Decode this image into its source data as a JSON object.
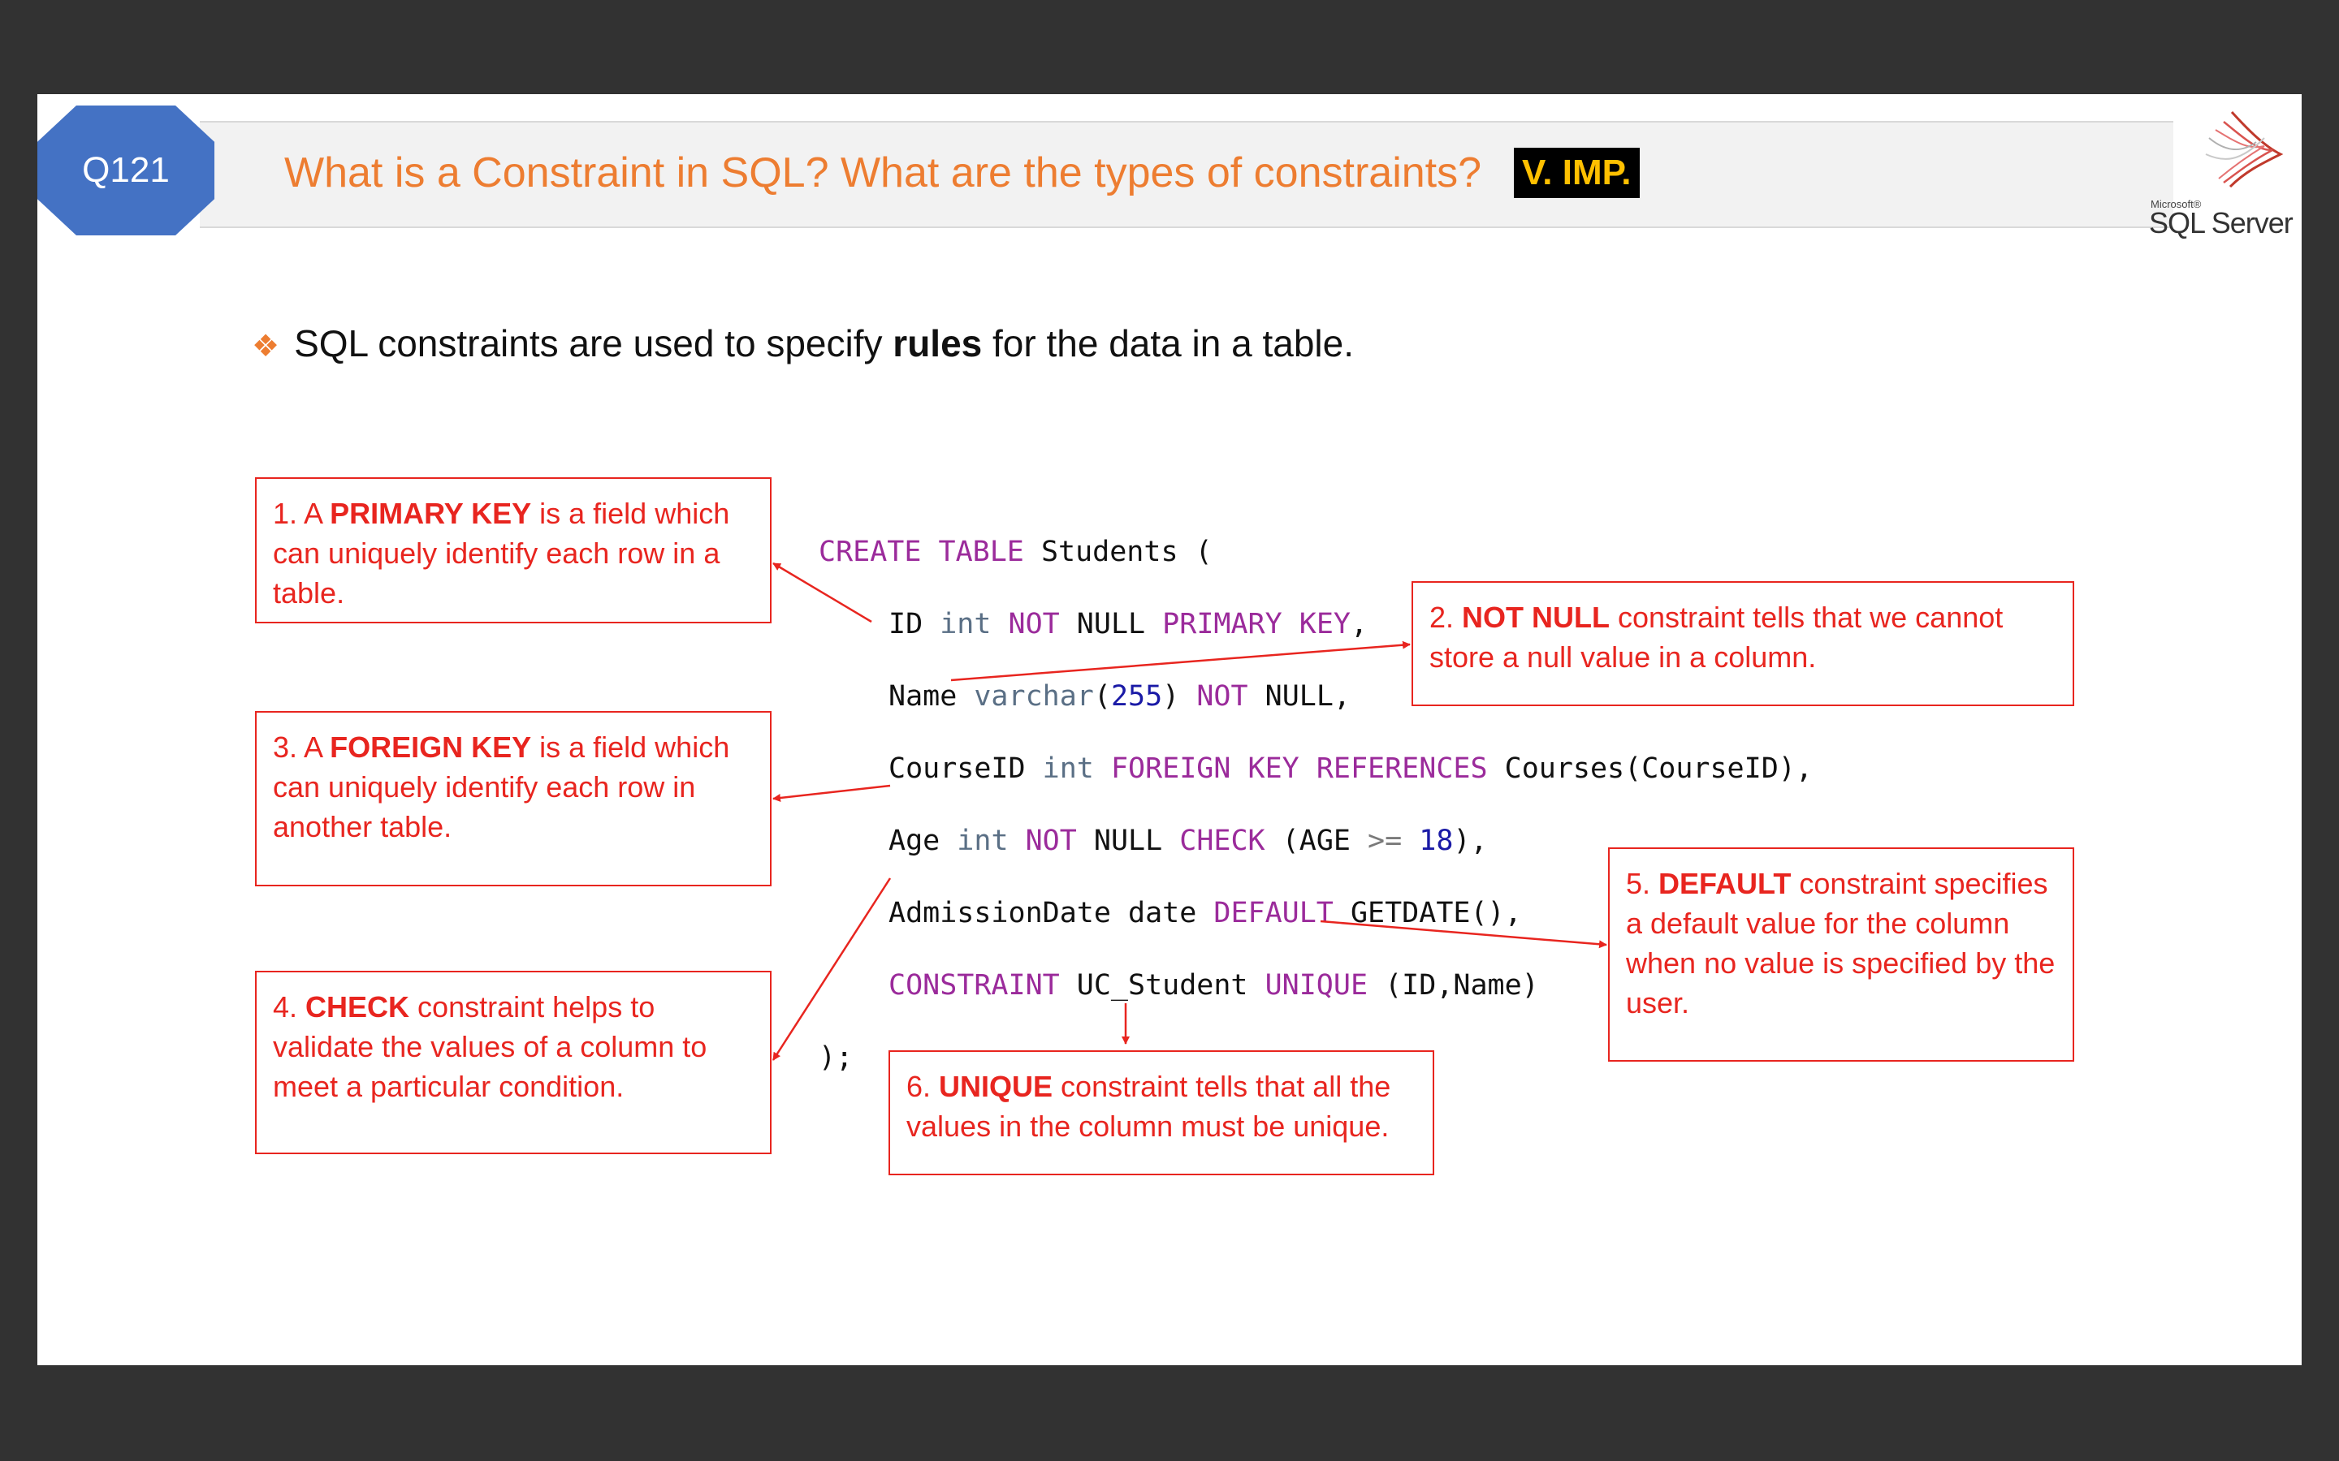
{
  "header": {
    "badge": "Q121",
    "title": "What is a Constraint in SQL? What are the types of constraints?",
    "tag": "V. IMP.",
    "logo_small": "Microsoft®",
    "logo_text": "SQL Server"
  },
  "intro": {
    "bullet_icon": "diamond-bullet-icon",
    "before": "SQL constraints are used to specify ",
    "bold": "rules",
    "after": " for the data in a table."
  },
  "boxes": {
    "primary_key": {
      "num": "1. A ",
      "bold": "PRIMARY KEY",
      "rest": " is a field which can uniquely identify each row in a table."
    },
    "not_null": {
      "num": "2. ",
      "bold": "NOT NULL",
      "rest": " constraint tells that we cannot store a null value in a column."
    },
    "foreign_key": {
      "num": "3. A ",
      "bold": "FOREIGN KEY",
      "rest": " is a field which can uniquely identify each row in another table."
    },
    "check": {
      "num": "4. ",
      "bold": "CHECK",
      "rest": " constraint helps to validate the values of a column to meet a particular condition."
    },
    "default": {
      "num": "5. ",
      "bold": "DEFAULT",
      "rest": " constraint specifies a default value for the column when no value is specified by the user."
    },
    "unique": {
      "num": "6. ",
      "bold": "UNIQUE",
      "rest": " constraint tells that all the values in the column must be unique."
    }
  },
  "code": {
    "l1": {
      "kw": "CREATE TABLE",
      "rest": " Students ("
    },
    "l2": {
      "a": "ID ",
      "b": "int",
      "c": " ",
      "d": "NOT",
      "e": " NULL ",
      "f": "PRIMARY KEY",
      "g": ","
    },
    "l3": {
      "a": "Name ",
      "b": "varchar",
      "c": "(",
      "d": "255",
      "e": ") ",
      "f": "NOT",
      "g": " NULL,"
    },
    "l4": {
      "a": "CourseID ",
      "b": "int",
      "c": " ",
      "d": "FOREIGN KEY REFERENCES",
      "e": " Courses(CourseID),"
    },
    "l5": {
      "a": "Age ",
      "b": "int",
      "c": " ",
      "d": "NOT",
      "e": " NULL ",
      "f": "CHECK",
      "g": " (AGE ",
      "h": ">=",
      "i": " ",
      "j": "18",
      "k": "),"
    },
    "l6": {
      "a": "AdmissionDate date ",
      "b": "DEFAULT",
      "c": " GETDATE(),"
    },
    "l7": {
      "a": "CONSTRAINT",
      "b": " UC_Student ",
      "c": "UNIQUE",
      "d": " (ID,Name)"
    },
    "l8": ");"
  },
  "colors": {
    "accent_orange": "#ed7d31",
    "badge_blue": "#4472c4",
    "annotation_red": "#e8251f",
    "keyword_purple": "#9b2b9b",
    "tag_yellow": "#ffc000"
  }
}
